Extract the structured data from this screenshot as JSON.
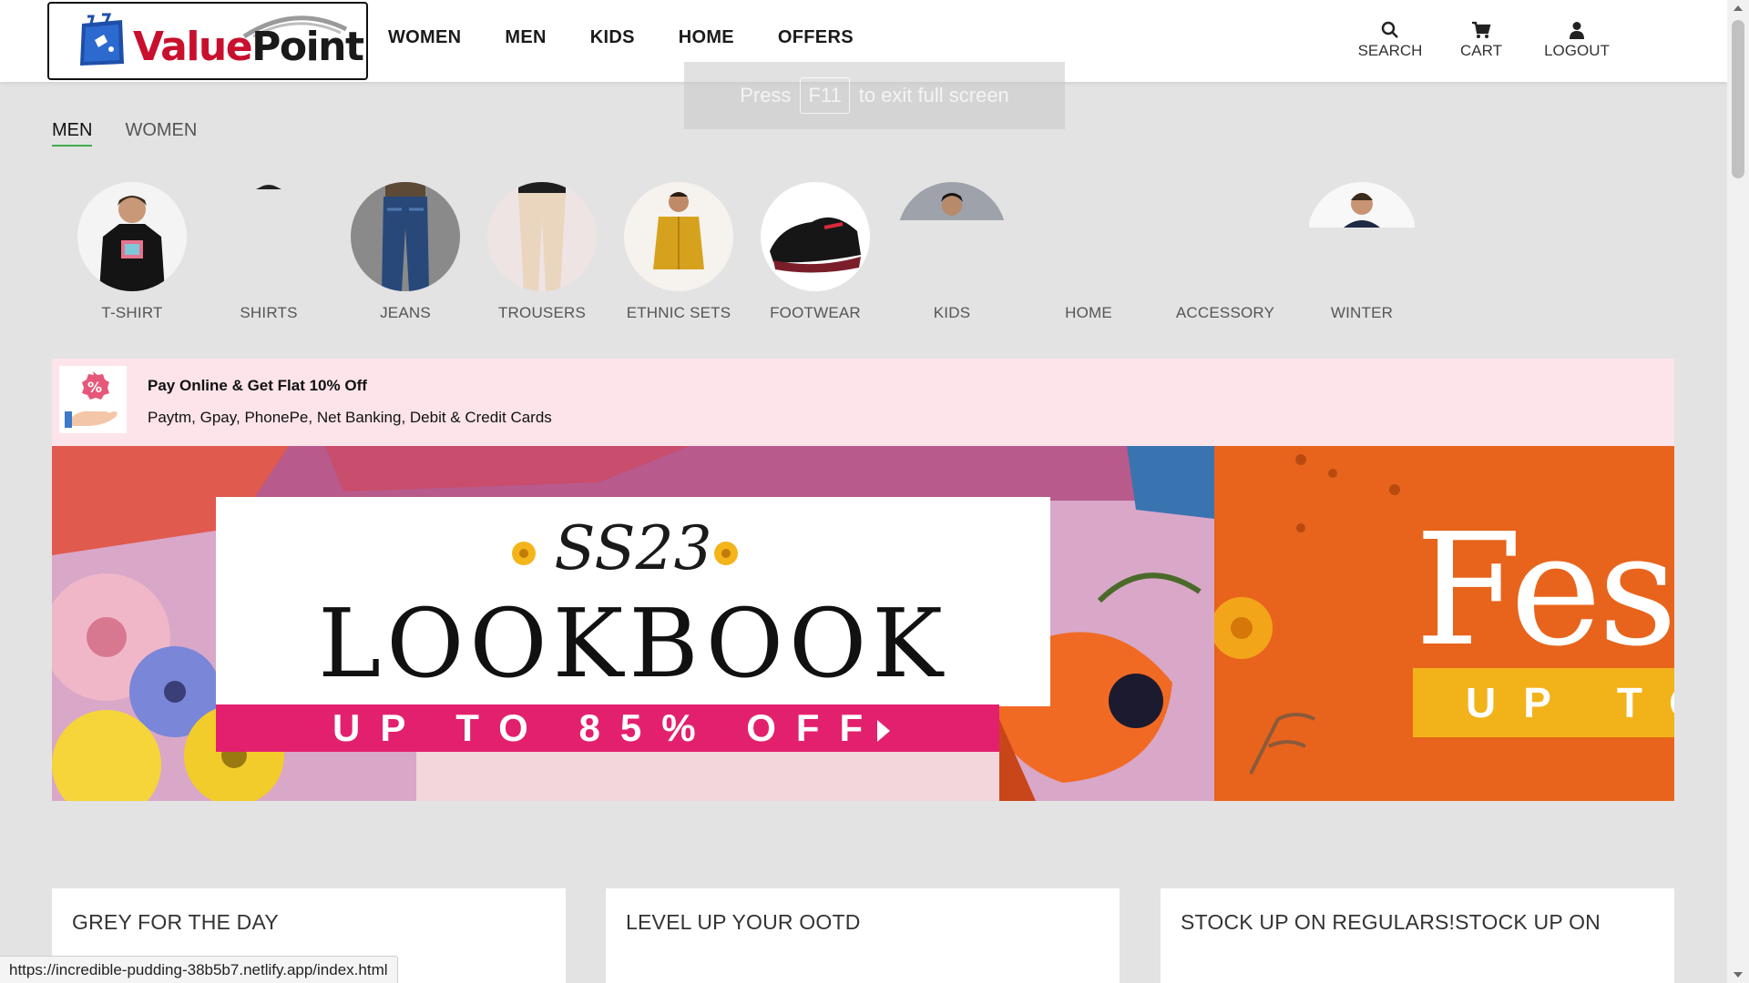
{
  "brand": {
    "logo_text_value": "Value",
    "logo_text_point": "Point"
  },
  "nav": [
    "WOMEN",
    "MEN",
    "KIDS",
    "HOME",
    "OFFERS"
  ],
  "header_actions": {
    "search": "SEARCH",
    "cart": "CART",
    "logout": "LOGOUT"
  },
  "fullscreen_toast": {
    "press": "Press",
    "key": "F11",
    "rest": "to exit full screen"
  },
  "gender_tabs": {
    "men": "MEN",
    "women": "WOMEN",
    "active": "MEN"
  },
  "categories": [
    "T-SHIRT",
    "SHIRTS",
    "JEANS",
    "TROUSERS",
    "ETHNIC SETS",
    "FOOTWEAR",
    "KIDS",
    "HOME",
    "ACCESSORY",
    "WINTER"
  ],
  "offer": {
    "title": "Pay Online & Get Flat 10% Off",
    "subtitle": "Paytm, Gpay, PhonePe, Net Banking, Debit & Credit Cards",
    "icon_symbol": "%"
  },
  "banner": {
    "ss": "SS23",
    "lookbook": "LOOKBOOK",
    "offer": "UP TO 85% OFF",
    "fest_text": "Fest",
    "fest_strip": "UP TO"
  },
  "sections": [
    "GREY FOR THE DAY",
    "LEVEL UP YOUR OOTD",
    "STOCK UP ON REGULARS!STOCK UP ON"
  ],
  "status_url": "https://incredible-pudding-38b5b7.netlify.app/index.html",
  "colors": {
    "accent_green": "#3fae49",
    "brand_red": "#c8102e",
    "offer_bg": "#fde4ea",
    "banner_pink": "#e3206e",
    "banner_orange": "#e8641c",
    "banner_yellow": "#f2b21a"
  }
}
